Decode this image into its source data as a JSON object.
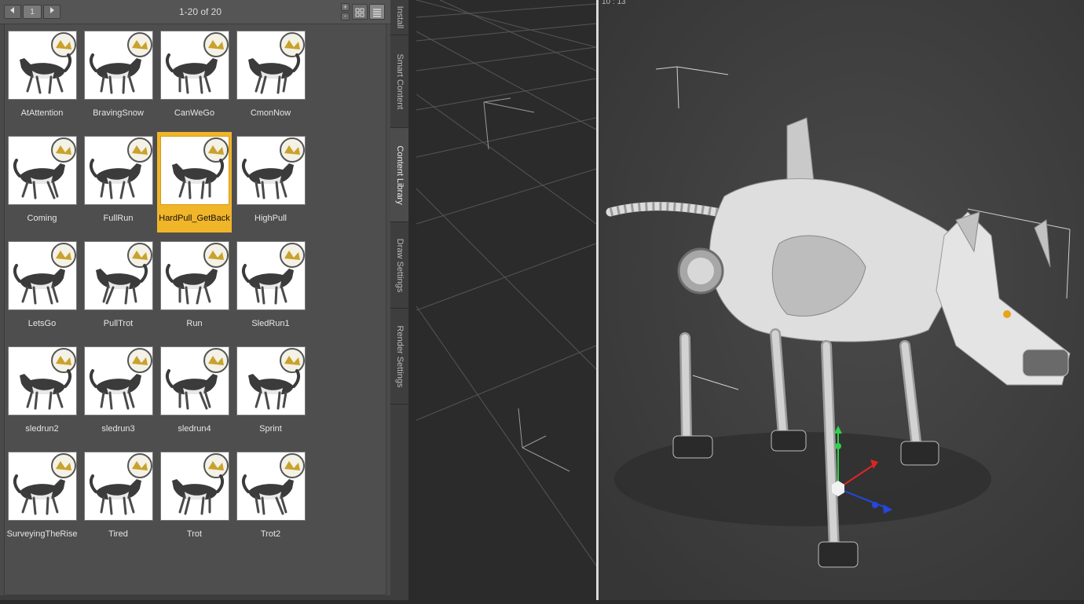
{
  "toolbar": {
    "prev_icon": "arrow-left-icon",
    "page_number": "1",
    "next_icon": "arrow-right-icon",
    "page_count": "1-20 of 20",
    "zoom_in_icon": "plus-icon",
    "zoom_out_icon": "minus-icon",
    "view_grid_icon": "grid-view-icon",
    "view_list_icon": "list-view-icon"
  },
  "items": [
    {
      "label": "AtAttention"
    },
    {
      "label": "BravingSnow"
    },
    {
      "label": "CanWeGo"
    },
    {
      "label": "CmonNow"
    },
    {
      "label": "Coming"
    },
    {
      "label": "FullRun"
    },
    {
      "label": "HardPull_GetBack"
    },
    {
      "label": "HighPull"
    },
    {
      "label": "LetsGo"
    },
    {
      "label": "PullTrot"
    },
    {
      "label": "Run"
    },
    {
      "label": "SledRun1"
    },
    {
      "label": "sledrun2"
    },
    {
      "label": "sledrun3"
    },
    {
      "label": "sledrun4"
    },
    {
      "label": "Sprint"
    },
    {
      "label": "SurveyingTheRise"
    },
    {
      "label": "Tired"
    },
    {
      "label": "Trot"
    },
    {
      "label": "Trot2"
    }
  ],
  "selected_item": "HardPull_GetBack",
  "side_tabs": [
    {
      "label": "Install"
    },
    {
      "label": "Smart Content"
    },
    {
      "label": "Content Library",
      "active": true
    },
    {
      "label": "Draw Settings"
    },
    {
      "label": "Render Settings"
    }
  ],
  "viewport": {
    "timecode": "10 : 13"
  },
  "colors": {
    "selection": "#f1b52a",
    "panel": "#4a4a4a",
    "viewport": "#3f3f3f",
    "gizmo_y": "#2fd14a",
    "gizmo_x": "#e02424",
    "gizmo_z": "#2447e0"
  }
}
